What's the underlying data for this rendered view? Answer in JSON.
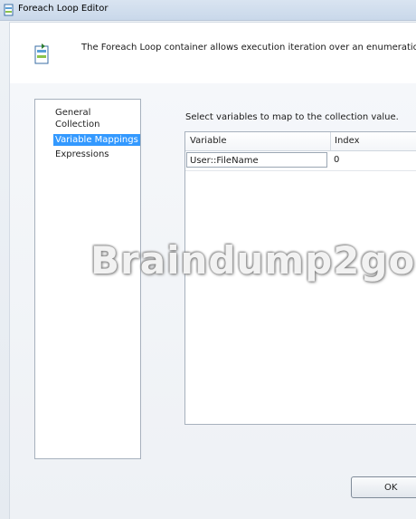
{
  "window": {
    "title": "Foreach Loop Editor",
    "title_icon": "foreach-loop-icon"
  },
  "header": {
    "icon": "foreach-container-icon",
    "description": "The Foreach Loop container allows execution iteration over an enumeration."
  },
  "nav": {
    "items": [
      {
        "label": "General",
        "selected": false
      },
      {
        "label": "Collection",
        "selected": false
      },
      {
        "label": "Variable Mappings",
        "selected": true
      },
      {
        "label": "Expressions",
        "selected": false
      }
    ]
  },
  "mappings": {
    "caption": "Select variables to map to the collection value.",
    "columns": [
      "Variable",
      "Index"
    ],
    "rows": [
      {
        "variable": "User::FileName",
        "index": "0"
      }
    ]
  },
  "watermark": "Braindump2go",
  "buttons": {
    "ok_label": "OK"
  },
  "colors": {
    "selection": "#3399ff",
    "titlebar": "#c9d8ea"
  }
}
